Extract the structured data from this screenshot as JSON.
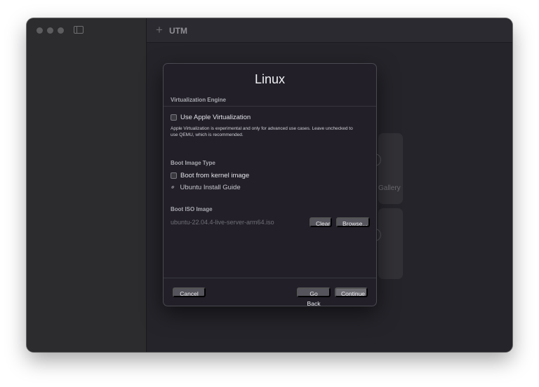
{
  "window": {
    "title": "UTM"
  },
  "background": {
    "gallery_text": "Gallery"
  },
  "dialog": {
    "title": "Linux",
    "virtualization_engine": {
      "header": "Virtualization Engine",
      "checkbox_label": "Use Apple Virtualization",
      "checked": false,
      "note": "Apple Virtualization is experimental and only for advanced use cases. Leave unchecked to use QEMU, which is recommended."
    },
    "boot_image_type": {
      "header": "Boot Image Type",
      "checkbox_label": "Boot from kernel image",
      "checked": false,
      "guide_link": "Ubuntu Install Guide"
    },
    "boot_iso": {
      "header": "Boot ISO Image",
      "value": "ubuntu-22.04.4-live-server-arm64.iso",
      "clear_label": "Clear",
      "browse_label": "Browse..."
    },
    "footer": {
      "cancel_label": "Cancel",
      "go_back_label": "Go Back",
      "continue_label": "Continue"
    }
  },
  "icons": [
    "close-dot-icon",
    "minimize-dot-icon",
    "zoom-dot-icon",
    "sidebar-toggle-icon",
    "plus-icon",
    "link-icon"
  ]
}
